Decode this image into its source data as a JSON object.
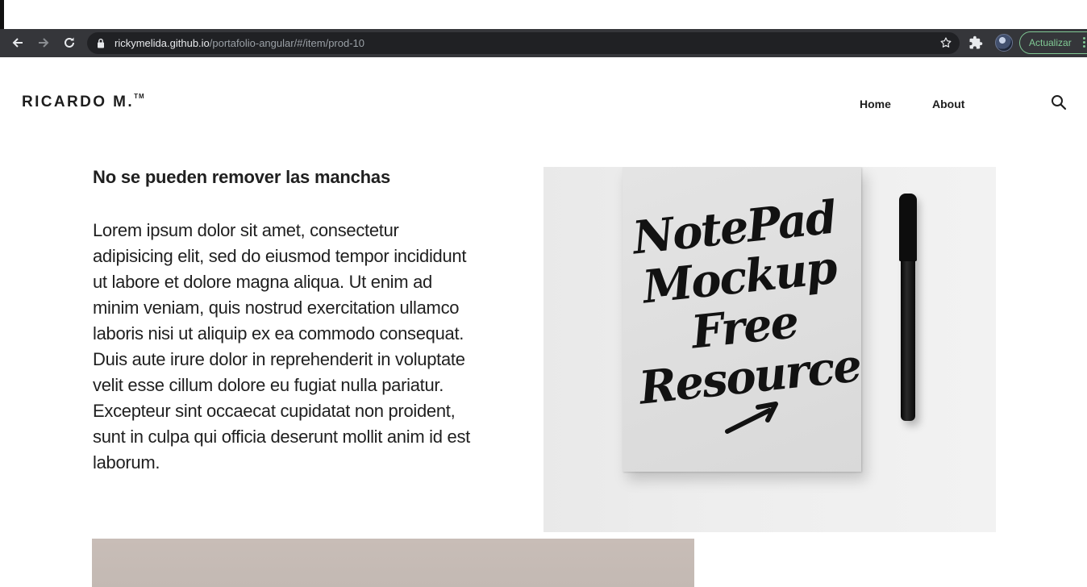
{
  "browser": {
    "url_host": "rickymelida.github.io",
    "url_path": "/portafolio-angular/#/item/prod-10",
    "update_label": "Actualizar"
  },
  "header": {
    "brand": "RICARDO M.",
    "brand_mark": "TM",
    "nav": [
      {
        "label": "Home"
      },
      {
        "label": "About"
      }
    ]
  },
  "product": {
    "title": "No se pueden remover las manchas",
    "description": "Lorem ipsum dolor sit amet, consectetur adipisicing elit, sed do eiusmod tempor incididunt ut labore et dolore magna aliqua. Ut enim ad minim veniam, quis nostrud exercitation ullamco laboris nisi ut aliquip ex ea commodo consequat. Duis aute irure dolor in reprehenderit in voluptate velit esse cillum dolore eu fugiat nulla pariatur. Excepteur sint occaecat cupidatat non proident, sunt in culpa qui officia deserunt mollit anim id est laborum.",
    "image_text": [
      "NotePad",
      "Mockup",
      "Free",
      "Resource"
    ]
  },
  "icons": {
    "back": "arrow-left-icon",
    "forward": "arrow-right-icon",
    "reload": "reload-icon",
    "lock": "lock-icon",
    "bookmark": "star-icon",
    "extensions": "puzzle-icon",
    "profile": "avatar",
    "menu": "kebab-menu-icon",
    "site_search": "search-icon"
  },
  "colors": {
    "toolbar": "#35363a",
    "omnibox": "#202124",
    "update_accent": "#81c995",
    "text": "#1f1f1f"
  }
}
